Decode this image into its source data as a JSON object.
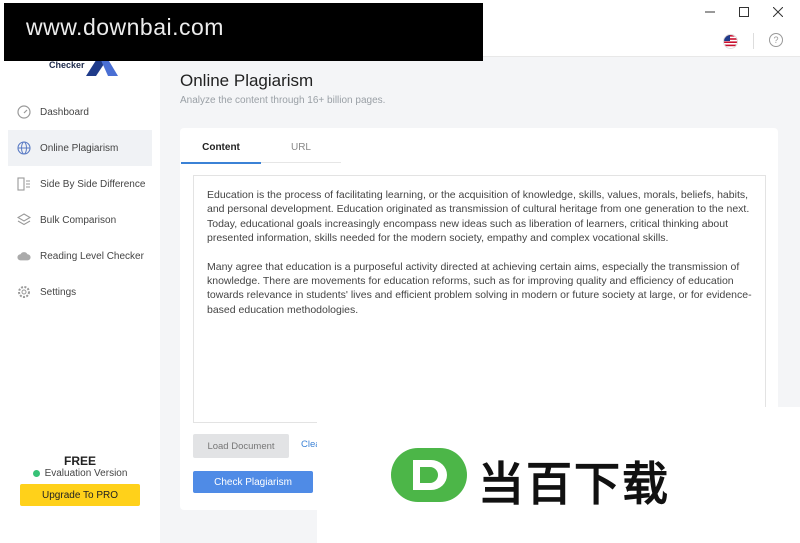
{
  "app": {
    "logo_text": "Checker"
  },
  "sidebar": {
    "items": [
      {
        "label": "Dashboard",
        "icon": "dashboard-gauge-icon"
      },
      {
        "label": "Online Plagiarism",
        "icon": "globe-icon",
        "active": true
      },
      {
        "label": "Side By Side Difference",
        "icon": "document-compare-icon"
      },
      {
        "label": "Bulk Comparison",
        "icon": "layers-icon"
      },
      {
        "label": "Reading Level Checker",
        "icon": "cloud-icon"
      },
      {
        "label": "Settings",
        "icon": "gear-icon"
      }
    ],
    "plan": "FREE",
    "plan_status": "Evaluation Version",
    "upgrade_label": "Upgrade To PRO"
  },
  "main": {
    "title": "Online Plagiarism",
    "subtitle": "Analyze the content through 16+ billion pages.",
    "tabs": [
      {
        "label": "Content",
        "active": true
      },
      {
        "label": "URL"
      }
    ],
    "paragraphs": [
      "Education is the process of facilitating learning, or the acquisition of knowledge, skills, values, morals, beliefs, habits, and personal development. Education originated as transmission of cultural heritage from one generation to the next. Today, educational goals increasingly encompass new ideas such as liberation of learners, critical thinking about presented information, skills needed for the modern society, empathy and complex vocational skills.",
      "Many agree that education is a purposeful activity directed at achieving certain aims, especially the transmission of knowledge. There are movements for education reforms, such as for improving quality and efficiency of education towards relevance in students' lives and efficient problem solving in modern or future society at large, or for evidence-based education methodologies."
    ],
    "load_label": "Load Document",
    "clear_label": "Clea",
    "check_label": "Check Plagiarism"
  },
  "watermark": {
    "top_text": "www.downbai.com",
    "bottom_text": "当百下载",
    "logo_letter": "D"
  },
  "colors": {
    "accent": "#4f8be6",
    "upgrade": "#ffd11a",
    "status_dot": "#37c277",
    "tab_underline": "#3b82d6"
  }
}
